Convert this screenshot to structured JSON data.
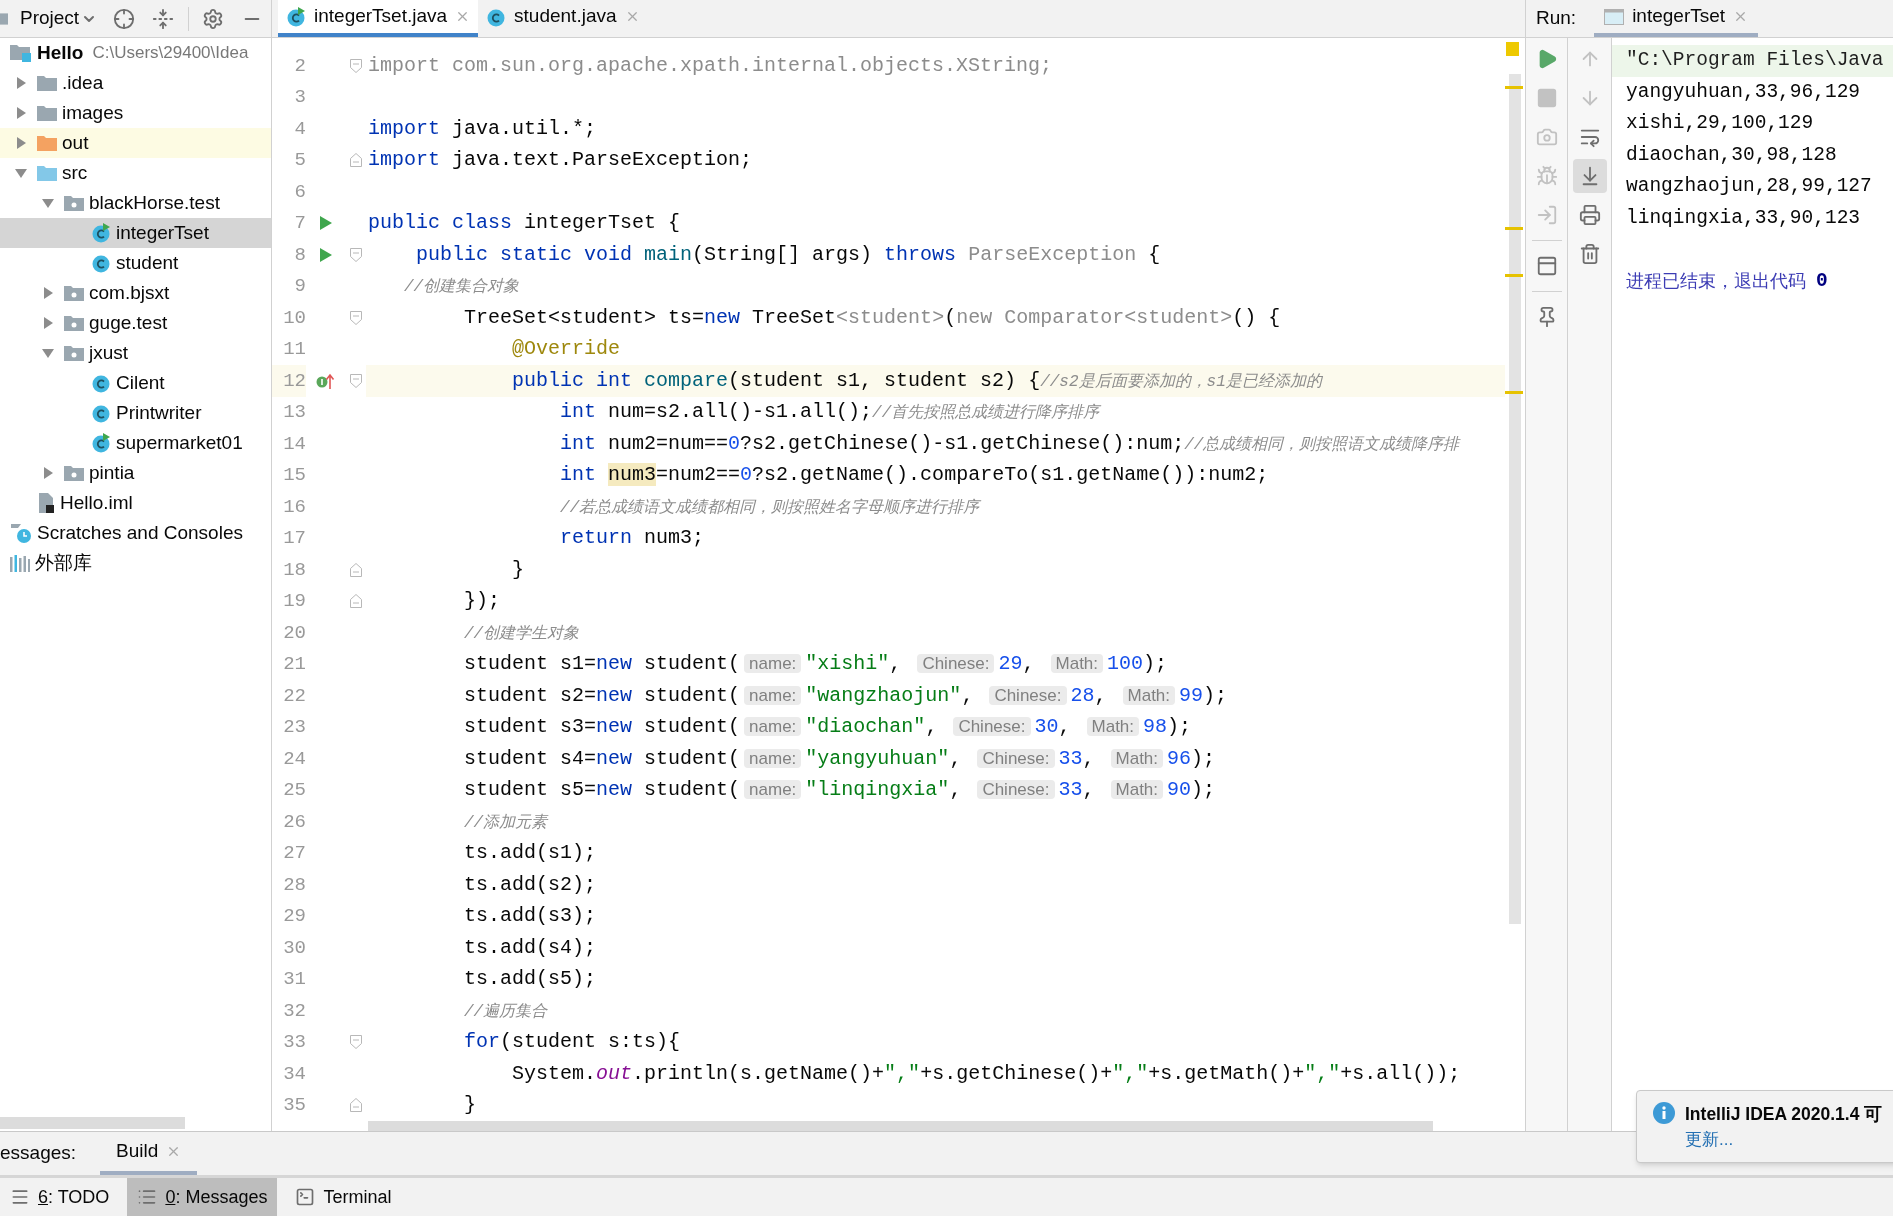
{
  "project_panel": {
    "title": "Project",
    "tree": [
      {
        "label": "Hello",
        "kind": "module",
        "path": "C:\\Users\\29400\\Idea",
        "selected": false,
        "children": [
          {
            "label": ".idea",
            "kind": "folder",
            "expanded": false,
            "selected": false
          },
          {
            "label": "images",
            "kind": "folder",
            "expanded": false,
            "selected": false
          },
          {
            "label": "out",
            "kind": "excluded-folder",
            "expanded": false,
            "selected": false
          },
          {
            "label": "src",
            "kind": "source-folder",
            "expanded": true,
            "selected": false,
            "children": [
              {
                "label": "blackHorse.test",
                "kind": "package",
                "expanded": true,
                "selected": false,
                "children": [
                  {
                    "label": "integerTset",
                    "kind": "runnable-class",
                    "selected": true
                  },
                  {
                    "label": "student",
                    "kind": "class",
                    "selected": false
                  }
                ]
              },
              {
                "label": "com.bjsxt",
                "kind": "package",
                "expanded": false,
                "selected": false
              },
              {
                "label": "guge.test",
                "kind": "package",
                "expanded": false,
                "selected": false
              },
              {
                "label": "jxust",
                "kind": "package",
                "expanded": true,
                "selected": false,
                "children": [
                  {
                    "label": "Cilent",
                    "kind": "class",
                    "selected": false
                  },
                  {
                    "label": "Printwriter",
                    "kind": "class",
                    "selected": false
                  },
                  {
                    "label": "supermarket01",
                    "kind": "runnable-class",
                    "selected": false
                  }
                ]
              },
              {
                "label": "pintia",
                "kind": "package",
                "expanded": false,
                "selected": false
              }
            ]
          },
          {
            "label": "Hello.iml",
            "kind": "module-file",
            "selected": false
          }
        ]
      },
      {
        "label": "Scratches and Consoles",
        "kind": "scratches",
        "selected": false
      },
      {
        "label": "外部库",
        "kind": "library",
        "selected": false
      }
    ]
  },
  "editor": {
    "tabs": [
      {
        "label": "integerTset.java",
        "kind": "runnable-class",
        "selected": true
      },
      {
        "label": "student.java",
        "kind": "class",
        "selected": false
      }
    ],
    "lines": [
      {
        "number": "2",
        "current": false,
        "markers": [
          {
            "kind": "fold-start"
          }
        ],
        "tokens": [
          {
            "kind": "unused",
            "text": "import com.sun.org.apache.xpath.internal.objects.XString;"
          }
        ]
      },
      {
        "number": "3",
        "current": false
      },
      {
        "number": "4",
        "current": false,
        "tokens": [
          {
            "kind": "keyword",
            "text": "import"
          },
          {
            "kind": "plain",
            "text": " java.util.*;"
          }
        ]
      },
      {
        "number": "5",
        "current": false,
        "markers": [
          {
            "kind": "fold-end"
          }
        ],
        "tokens": [
          {
            "kind": "keyword",
            "text": "import"
          },
          {
            "kind": "plain",
            "text": " java.text.ParseException;"
          }
        ]
      },
      {
        "number": "6",
        "current": false
      },
      {
        "number": "7",
        "current": false,
        "markers": [
          {
            "kind": "run"
          }
        ],
        "tokens": [
          {
            "kind": "keyword",
            "text": "public class"
          },
          {
            "kind": "plain",
            "text": " integerTset {"
          }
        ]
      },
      {
        "number": "8",
        "current": false,
        "markers": [
          {
            "kind": "run"
          },
          {
            "kind": "fold-start"
          }
        ],
        "tokens": [
          {
            "kind": "keyword",
            "text": "    public static void "
          },
          {
            "kind": "method",
            "text": "main"
          },
          {
            "kind": "plain",
            "text": "(String[] args) "
          },
          {
            "kind": "keyword",
            "text": "throws "
          },
          {
            "kind": "unused",
            "text": "ParseException"
          },
          {
            "kind": "plain",
            "text": " {"
          }
        ]
      },
      {
        "number": "9",
        "current": false,
        "tokens": [
          {
            "kind": "comment",
            "text": "   //创建集合对象"
          }
        ]
      },
      {
        "number": "10",
        "current": false,
        "markers": [
          {
            "kind": "fold-start"
          }
        ],
        "tokens": [
          {
            "kind": "plain",
            "text": "        TreeSet<student> ts="
          },
          {
            "kind": "keyword",
            "text": "new"
          },
          {
            "kind": "plain",
            "text": " TreeSet"
          },
          {
            "kind": "unused",
            "text": "<student>"
          },
          {
            "kind": "plain",
            "text": "("
          },
          {
            "kind": "unused",
            "text": "new Comparator<student>"
          },
          {
            "kind": "plain",
            "text": "() {"
          }
        ]
      },
      {
        "number": "11",
        "current": false,
        "tokens": [
          {
            "kind": "annotation",
            "text": "            @Override"
          }
        ]
      },
      {
        "number": "12",
        "current": true,
        "markers": [
          {
            "kind": "override"
          },
          {
            "kind": "fold-start"
          }
        ],
        "tokens": [
          {
            "kind": "keyword",
            "text": "            public int "
          },
          {
            "kind": "method",
            "text": "compare"
          },
          {
            "kind": "plain",
            "text": "(student s1, student s2) {"
          },
          {
            "kind": "comment",
            "text": "//s2是后面要添加的，s1是已经添加的"
          }
        ]
      },
      {
        "number": "13",
        "current": false,
        "tokens": [
          {
            "kind": "keyword",
            "text": "                int"
          },
          {
            "kind": "plain",
            "text": " num=s2.all()-s1.all();"
          },
          {
            "kind": "comment",
            "text": "//首先按照总成绩进行降序排序"
          }
        ]
      },
      {
        "number": "14",
        "current": false,
        "tokens": [
          {
            "kind": "keyword",
            "text": "                int"
          },
          {
            "kind": "plain",
            "text": " num2=num=="
          },
          {
            "kind": "number",
            "text": "0"
          },
          {
            "kind": "plain",
            "text": "?s2.getChinese()-s1.getChinese():num;"
          },
          {
            "kind": "comment",
            "text": "//总成绩相同，则按照语文成绩降序排"
          }
        ]
      },
      {
        "number": "15",
        "current": false,
        "tokens": [
          {
            "kind": "keyword",
            "text": "                int "
          },
          {
            "kind": "usage",
            "text": "num3"
          },
          {
            "kind": "plain",
            "text": "=num2=="
          },
          {
            "kind": "number",
            "text": "0"
          },
          {
            "kind": "plain",
            "text": "?s2.getName().compareTo(s1.getName()):num2;"
          }
        ]
      },
      {
        "number": "16",
        "current": false,
        "tokens": [
          {
            "kind": "comment",
            "text": "                //若总成绩语文成绩都相同，则按照姓名字母顺序进行排序"
          }
        ]
      },
      {
        "number": "17",
        "current": false,
        "tokens": [
          {
            "kind": "keyword",
            "text": "                return"
          },
          {
            "kind": "plain",
            "text": " num3;"
          }
        ]
      },
      {
        "number": "18",
        "current": false,
        "markers": [
          {
            "kind": "fold-end"
          }
        ],
        "tokens": [
          {
            "kind": "plain",
            "text": "            }"
          }
        ]
      },
      {
        "number": "19",
        "current": false,
        "markers": [
          {
            "kind": "fold-end"
          }
        ],
        "tokens": [
          {
            "kind": "plain",
            "text": "        });"
          }
        ]
      },
      {
        "number": "20",
        "current": false,
        "tokens": [
          {
            "kind": "comment",
            "text": "        //创建学生对象"
          }
        ]
      },
      {
        "number": "21",
        "current": false,
        "tokens": [
          {
            "kind": "plain",
            "text": "        student s1="
          },
          {
            "kind": "keyword",
            "text": "new"
          },
          {
            "kind": "plain",
            "text": " student("
          },
          {
            "kind": "hint",
            "text": "name:"
          },
          {
            "kind": "string",
            "text": "\"xishi\""
          },
          {
            "kind": "plain",
            "text": ", "
          },
          {
            "kind": "hint",
            "text": "Chinese:"
          },
          {
            "kind": "number",
            "text": "29"
          },
          {
            "kind": "plain",
            "text": ", "
          },
          {
            "kind": "hint",
            "text": "Math:"
          },
          {
            "kind": "number",
            "text": "100"
          },
          {
            "kind": "plain",
            "text": ");"
          }
        ]
      },
      {
        "number": "22",
        "current": false,
        "tokens": [
          {
            "kind": "plain",
            "text": "        student s2="
          },
          {
            "kind": "keyword",
            "text": "new"
          },
          {
            "kind": "plain",
            "text": " student("
          },
          {
            "kind": "hint",
            "text": "name:"
          },
          {
            "kind": "string",
            "text": "\"wangzhaojun\""
          },
          {
            "kind": "plain",
            "text": ", "
          },
          {
            "kind": "hint",
            "text": "Chinese:"
          },
          {
            "kind": "number",
            "text": "28"
          },
          {
            "kind": "plain",
            "text": ", "
          },
          {
            "kind": "hint",
            "text": "Math:"
          },
          {
            "kind": "number",
            "text": "99"
          },
          {
            "kind": "plain",
            "text": ");"
          }
        ]
      },
      {
        "number": "23",
        "current": false,
        "tokens": [
          {
            "kind": "plain",
            "text": "        student s3="
          },
          {
            "kind": "keyword",
            "text": "new"
          },
          {
            "kind": "plain",
            "text": " student("
          },
          {
            "kind": "hint",
            "text": "name:"
          },
          {
            "kind": "string",
            "text": "\"diaochan\""
          },
          {
            "kind": "plain",
            "text": ", "
          },
          {
            "kind": "hint",
            "text": "Chinese:"
          },
          {
            "kind": "number",
            "text": "30"
          },
          {
            "kind": "plain",
            "text": ", "
          },
          {
            "kind": "hint",
            "text": "Math:"
          },
          {
            "kind": "number",
            "text": "98"
          },
          {
            "kind": "plain",
            "text": ");"
          }
        ]
      },
      {
        "number": "24",
        "current": false,
        "tokens": [
          {
            "kind": "plain",
            "text": "        student s4="
          },
          {
            "kind": "keyword",
            "text": "new"
          },
          {
            "kind": "plain",
            "text": " student("
          },
          {
            "kind": "hint",
            "text": "name:"
          },
          {
            "kind": "string",
            "text": "\"yangyuhuan\""
          },
          {
            "kind": "plain",
            "text": ", "
          },
          {
            "kind": "hint",
            "text": "Chinese:"
          },
          {
            "kind": "number",
            "text": "33"
          },
          {
            "kind": "plain",
            "text": ", "
          },
          {
            "kind": "hint",
            "text": "Math:"
          },
          {
            "kind": "number",
            "text": "96"
          },
          {
            "kind": "plain",
            "text": ");"
          }
        ]
      },
      {
        "number": "25",
        "current": false,
        "tokens": [
          {
            "kind": "plain",
            "text": "        student s5="
          },
          {
            "kind": "keyword",
            "text": "new"
          },
          {
            "kind": "plain",
            "text": " student("
          },
          {
            "kind": "hint",
            "text": "name:"
          },
          {
            "kind": "string",
            "text": "\"linqingxia\""
          },
          {
            "kind": "plain",
            "text": ", "
          },
          {
            "kind": "hint",
            "text": "Chinese:"
          },
          {
            "kind": "number",
            "text": "33"
          },
          {
            "kind": "plain",
            "text": ", "
          },
          {
            "kind": "hint",
            "text": "Math:"
          },
          {
            "kind": "number",
            "text": "90"
          },
          {
            "kind": "plain",
            "text": ");"
          }
        ]
      },
      {
        "number": "26",
        "current": false,
        "tokens": [
          {
            "kind": "comment",
            "text": "        //添加元素"
          }
        ]
      },
      {
        "number": "27",
        "current": false,
        "tokens": [
          {
            "kind": "plain",
            "text": "        ts.add(s1);"
          }
        ]
      },
      {
        "number": "28",
        "current": false,
        "tokens": [
          {
            "kind": "plain",
            "text": "        ts.add(s2);"
          }
        ]
      },
      {
        "number": "29",
        "current": false,
        "tokens": [
          {
            "kind": "plain",
            "text": "        ts.add(s3);"
          }
        ]
      },
      {
        "number": "30",
        "current": false,
        "tokens": [
          {
            "kind": "plain",
            "text": "        ts.add(s4);"
          }
        ]
      },
      {
        "number": "31",
        "current": false,
        "tokens": [
          {
            "kind": "plain",
            "text": "        ts.add(s5);"
          }
        ]
      },
      {
        "number": "32",
        "current": false,
        "tokens": [
          {
            "kind": "comment",
            "text": "        //遍历集合"
          }
        ]
      },
      {
        "number": "33",
        "current": false,
        "markers": [
          {
            "kind": "fold-start"
          }
        ],
        "tokens": [
          {
            "kind": "keyword",
            "text": "        for"
          },
          {
            "kind": "plain",
            "text": "(student s:ts){"
          }
        ]
      },
      {
        "number": "34",
        "current": false,
        "tokens": [
          {
            "kind": "plain",
            "text": "            System."
          },
          {
            "kind": "field",
            "text": "out"
          },
          {
            "kind": "plain",
            "text": ".println(s.getName()+"
          },
          {
            "kind": "string",
            "text": "\",\""
          },
          {
            "kind": "plain",
            "text": "+s.getChinese()+"
          },
          {
            "kind": "string",
            "text": "\",\""
          },
          {
            "kind": "plain",
            "text": "+s.getMath()+"
          },
          {
            "kind": "string",
            "text": "\",\""
          },
          {
            "kind": "plain",
            "text": "+s.all());"
          }
        ]
      },
      {
        "number": "35",
        "current": false,
        "markers": [
          {
            "kind": "fold-end"
          }
        ],
        "tokens": [
          {
            "kind": "plain",
            "text": "        }"
          }
        ]
      }
    ]
  },
  "run_panel": {
    "label": "Run:",
    "tabs": [
      {
        "label": "integerTset",
        "selected": true
      }
    ],
    "toolbar_left": [
      {
        "kind": "run",
        "disabled": false
      },
      {
        "kind": "stop",
        "disabled": true
      },
      {
        "kind": "camera",
        "disabled": true
      },
      {
        "kind": "debug",
        "disabled": true
      },
      {
        "kind": "export",
        "disabled": true
      },
      {
        "kind": "layout",
        "disabled": false
      },
      {
        "kind": "pin",
        "disabled": false
      }
    ],
    "toolbar_right": [
      {
        "kind": "up",
        "selected": false,
        "disabled": true
      },
      {
        "kind": "down",
        "selected": false,
        "disabled": true
      },
      {
        "kind": "wrap",
        "selected": false,
        "disabled": false
      },
      {
        "kind": "scroll-end",
        "selected": true,
        "disabled": false
      },
      {
        "kind": "print",
        "selected": false,
        "disabled": false
      },
      {
        "kind": "trash",
        "selected": false,
        "disabled": false
      }
    ],
    "console": [
      {
        "kind": "command",
        "text": "\"C:\\Program Files\\Java"
      },
      {
        "kind": "output",
        "text": "yangyuhuan,33,96,129"
      },
      {
        "kind": "output",
        "text": "xishi,29,100,129"
      },
      {
        "kind": "output",
        "text": "diaochan,30,98,128"
      },
      {
        "kind": "output",
        "text": "wangzhaojun,28,99,127"
      },
      {
        "kind": "output",
        "text": "linqingxia,33,90,123"
      },
      {
        "kind": "blank"
      },
      {
        "kind": "exit",
        "text": "进程已结束，退出代码",
        "code": "0"
      }
    ]
  },
  "notification": {
    "title": "IntelliJ IDEA 2020.1.4 可",
    "link": "更新..."
  },
  "messages_panel": {
    "label": "essages:",
    "tabs": [
      {
        "label": "Build",
        "selected": true
      }
    ]
  },
  "bottom_bar": {
    "tabs": [
      {
        "kind": "todo",
        "mnemonic": "6",
        "label": ": TODO",
        "selected": false
      },
      {
        "kind": "messages",
        "mnemonic": "0",
        "label": ": Messages",
        "selected": true
      },
      {
        "kind": "terminal",
        "label": "Terminal",
        "selected": false
      }
    ]
  }
}
